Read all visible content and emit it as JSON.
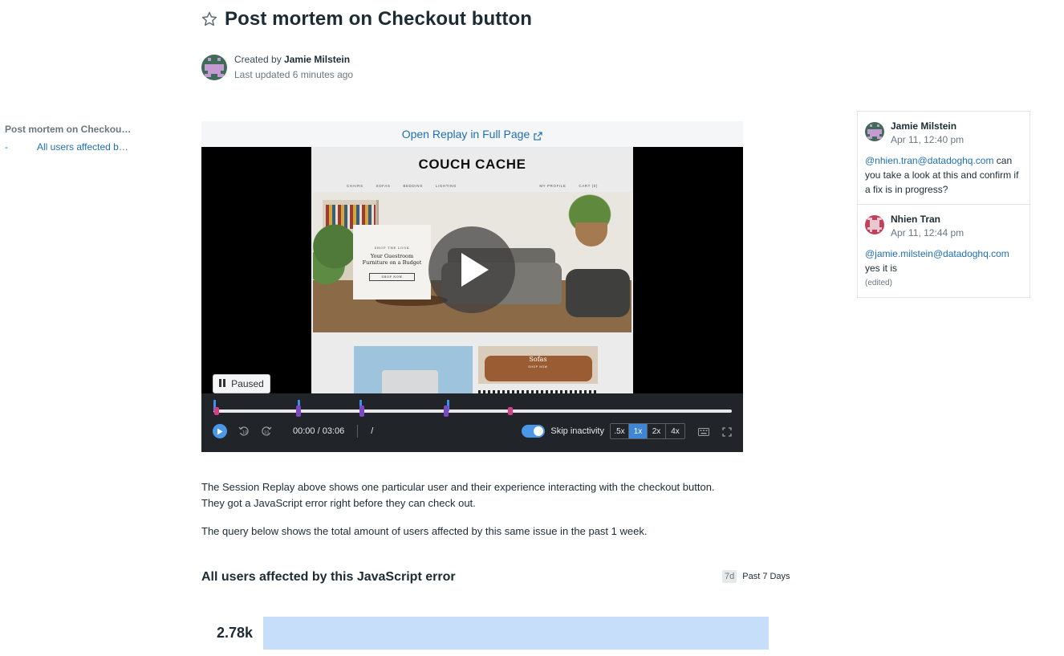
{
  "header": {
    "title": "Post mortem on Checkout button",
    "created_by_prefix": "Created by ",
    "author": "Jamie Milstein",
    "last_updated": "Last updated 6 minutes ago"
  },
  "toc": {
    "items": [
      {
        "label": "Post mortem on Checkout button"
      },
      {
        "label": "All users affected by this JavaScript error",
        "prefix": "-"
      }
    ]
  },
  "replay": {
    "open_link": "Open Replay in Full Page",
    "site": {
      "brand": "COUCH CACHE",
      "nav_left": [
        "CHAIRS",
        "SOFAS",
        "BEDDING",
        "LIGHTING"
      ],
      "nav_right": [
        "MY PROFILE",
        "CART (0)"
      ],
      "promo_kicker": "SHOP THE LOOK",
      "promo_heading": "Your Guestroom Furniture on a Budget",
      "promo_button": "SHOP NOW",
      "tile_title": "Sofas",
      "tile_sub": "SHOP NOW"
    },
    "status": "Paused",
    "time": "00:00 / 03:06",
    "slash": "/",
    "skip_label": "Skip inactivity",
    "skip_enabled": true,
    "speeds": [
      ".5x",
      "1x",
      "2x",
      "4x"
    ],
    "active_speed": "1x",
    "accent_color": "#4a97e8"
  },
  "body": {
    "paragraph_1": "The Session Replay above shows one particular user and their experience interacting with the checkout button. They got a JavaScript error right before they can check out.",
    "paragraph_2": "The query below shows the total amount of users affected by this same issue in the past 1 week."
  },
  "widget": {
    "title": "All users affected by this JavaScript error",
    "range_badge": "7d",
    "range_label": "Past 7 Days",
    "value": "2.78k",
    "bar_color": "#c7defa"
  },
  "comments": [
    {
      "author": "Jamie Milstein",
      "date": "Apr 11, 12:40 pm",
      "mention": "@nhien.tran@datadoghq.com",
      "text": " can you take a look at this and confirm if a fix is in progress?",
      "edited": ""
    },
    {
      "author": "Nhien Tran",
      "date": "Apr 11, 12:44 pm",
      "mention": "@jamie.milstein@datadoghq.com",
      "text": "yes it is",
      "edited": "(edited)"
    }
  ]
}
